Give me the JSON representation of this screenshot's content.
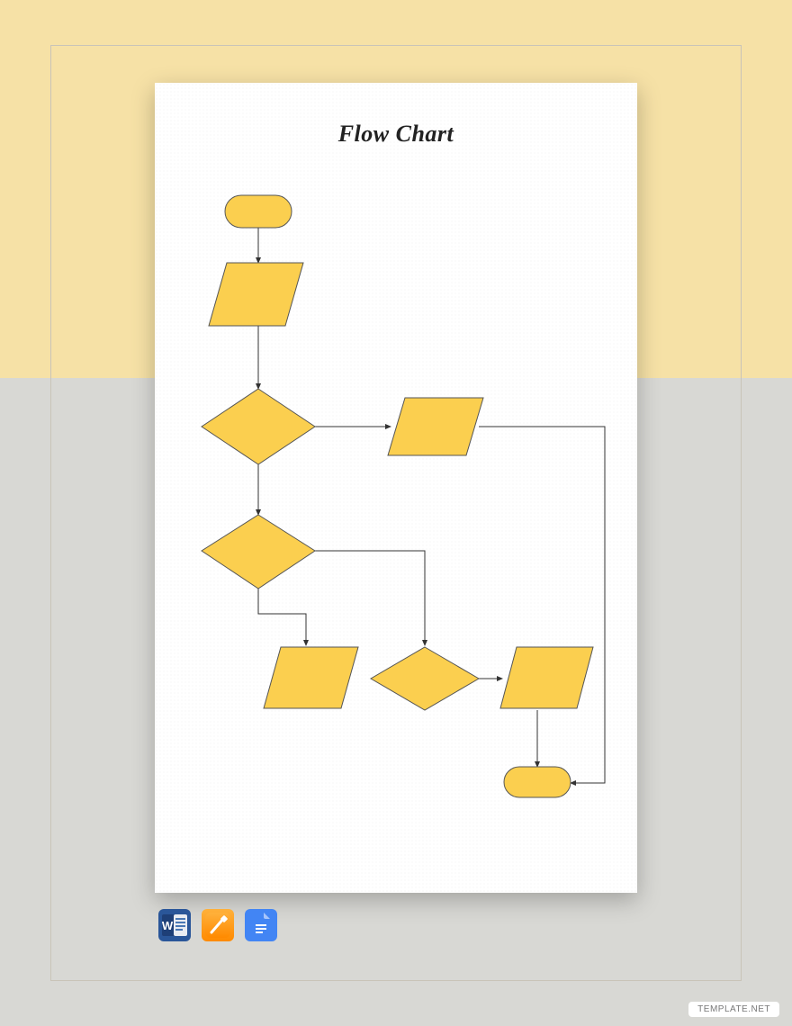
{
  "title": "Flow Chart",
  "watermark": "TEMPLATE.NET",
  "icons": [
    {
      "name": "word-icon"
    },
    {
      "name": "pages-icon"
    },
    {
      "name": "google-docs-icon"
    }
  ],
  "flowchart": {
    "nodes": [
      {
        "id": "start",
        "type": "terminator",
        "label": ""
      },
      {
        "id": "input1",
        "type": "parallelogram",
        "label": ""
      },
      {
        "id": "decision1",
        "type": "decision",
        "label": ""
      },
      {
        "id": "io1",
        "type": "parallelogram",
        "label": ""
      },
      {
        "id": "decision2",
        "type": "decision",
        "label": ""
      },
      {
        "id": "io2",
        "type": "parallelogram",
        "label": ""
      },
      {
        "id": "decision3",
        "type": "decision",
        "label": ""
      },
      {
        "id": "io3",
        "type": "parallelogram",
        "label": ""
      },
      {
        "id": "end",
        "type": "terminator",
        "label": ""
      }
    ],
    "connectors": [
      {
        "from": "start",
        "to": "input1"
      },
      {
        "from": "input1",
        "to": "decision1"
      },
      {
        "from": "decision1",
        "to": "io1",
        "branch": "right"
      },
      {
        "from": "decision1",
        "to": "decision2",
        "branch": "down"
      },
      {
        "from": "decision2",
        "to": "io2",
        "branch": "left-down"
      },
      {
        "from": "decision2",
        "to": "decision3",
        "branch": "right-down"
      },
      {
        "from": "decision3",
        "to": "io3",
        "branch": "right"
      },
      {
        "from": "io3",
        "to": "end"
      },
      {
        "from": "io1",
        "to": "end",
        "path": "long-right-loop"
      }
    ]
  }
}
